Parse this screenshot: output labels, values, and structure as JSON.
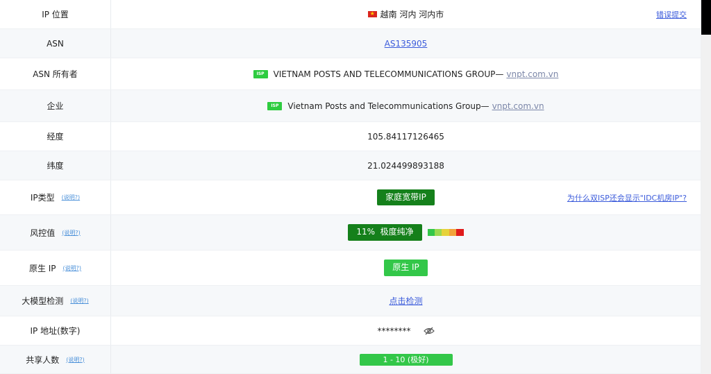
{
  "rows": {
    "location": {
      "label": "IP 位置",
      "value": "越南 河内 河内市",
      "link": "错误提交"
    },
    "asn": {
      "label": "ASN",
      "value": "AS135905"
    },
    "asn_owner": {
      "label": "ASN 所有者",
      "badge": "ISP",
      "value": "VIETNAM POSTS AND TELECOMMUNICATIONS GROUP—",
      "domain": "vnpt.com.vn"
    },
    "company": {
      "label": "企业",
      "badge": "ISP",
      "value": "Vietnam Posts and Telecommunications Group—",
      "domain": "vnpt.com.vn"
    },
    "longitude": {
      "label": "经度",
      "value": "105.84117126465"
    },
    "latitude": {
      "label": "纬度",
      "value": "21.024499893188"
    },
    "ip_type": {
      "label": "IP类型",
      "help": "(说明?)",
      "value": "家庭宽带IP",
      "link": "为什么双ISP还会显示\"IDC机房IP\"?"
    },
    "risk": {
      "label": "风控值",
      "help": "(说明?)",
      "value": "11%  极度纯净",
      "bar_colors": [
        "#33c749",
        "#9ad94f",
        "#e6d23a",
        "#f2a33a",
        "#e01b1b"
      ]
    },
    "native_ip": {
      "label": "原生 IP",
      "help": "(说明?)",
      "value": "原生 IP"
    },
    "llm_check": {
      "label": "大模型检测",
      "help": "(说明?)",
      "value": "点击检测"
    },
    "ip_numeric": {
      "label": "IP 地址(数字)",
      "value": "********"
    },
    "shared_users": {
      "label": "共享人数",
      "help": "(说明?)",
      "value": "1 - 10 (极好)"
    }
  },
  "colors": {
    "dark_green": "#15801b",
    "green": "#33c749",
    "link_blue": "#3b5bdb",
    "help_blue": "#4a90d9"
  }
}
